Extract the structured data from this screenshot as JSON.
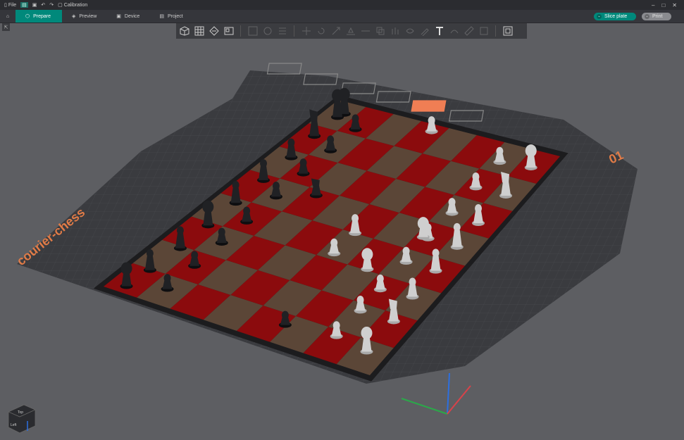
{
  "titlebar": {
    "file_label": "File",
    "calibration_label": "Calibration",
    "window_controls": [
      "–",
      "□",
      "✕"
    ]
  },
  "tabs": [
    {
      "label": "Prepare",
      "icon": "cube-icon",
      "active": true
    },
    {
      "label": "Preview",
      "icon": "layers-icon",
      "active": false
    },
    {
      "label": "Device",
      "icon": "device-icon",
      "active": false
    },
    {
      "label": "Project",
      "icon": "project-icon",
      "active": false
    }
  ],
  "actions": {
    "slice_label": "Slice plate",
    "print_label": "Print"
  },
  "plate": {
    "name": "courier-chess",
    "number": "01"
  },
  "nav_cube": {
    "top_label": "Top",
    "front_label": "Left"
  },
  "colors": {
    "accent": "#00897b",
    "red_square": "#8b0b0d",
    "brown_square": "#5b4637",
    "bed": "#3a3b3f",
    "plate_label": "#e07b47",
    "selected_icon": "#f07e54"
  }
}
